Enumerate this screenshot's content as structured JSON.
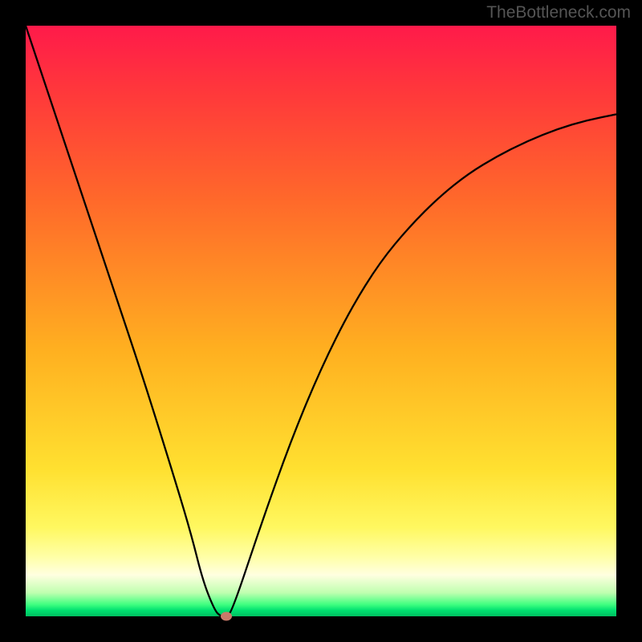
{
  "watermark": "TheBottleneck.com",
  "chart_data": {
    "type": "line",
    "title": "",
    "xlabel": "",
    "ylabel": "",
    "xlim": [
      0,
      100
    ],
    "ylim": [
      0,
      100
    ],
    "x": [
      0,
      5,
      10,
      15,
      20,
      25,
      28,
      30,
      32,
      33,
      34,
      35,
      40,
      45,
      50,
      55,
      60,
      65,
      70,
      75,
      80,
      85,
      90,
      95,
      100
    ],
    "values": [
      100,
      85,
      70,
      55,
      40,
      24,
      14,
      6,
      1,
      0,
      0,
      1,
      16,
      30,
      42,
      52,
      60,
      66,
      71,
      75,
      78,
      80.5,
      82.5,
      84,
      85
    ],
    "marker": {
      "x": 34,
      "y": 0
    },
    "background": "rainbow-gradient-red-to-green-vertical"
  }
}
